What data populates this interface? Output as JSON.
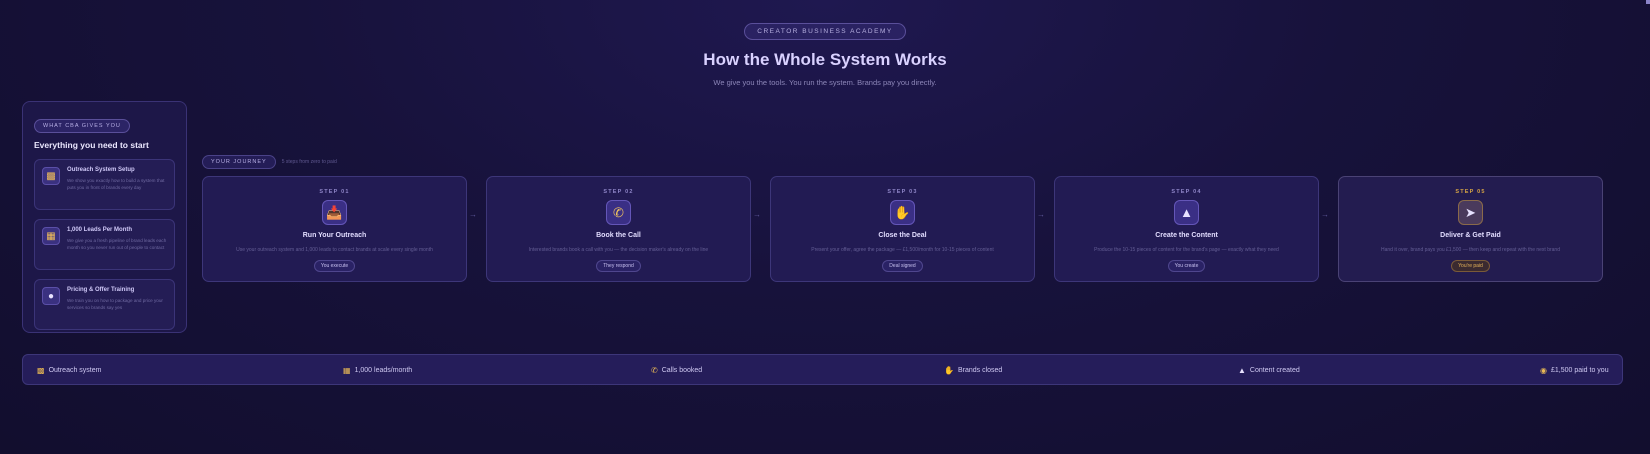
{
  "header": {
    "academy_label": "CREATOR BUSINESS ACADEMY",
    "title": "How the Whole System Works",
    "subtitle": "We give you the tools. You run the system. Brands pay you directly."
  },
  "sidebar": {
    "pill": "WHAT CBA GIVES YOU",
    "title": "Everything you need to start",
    "items": [
      {
        "icon": "folder-icon",
        "title": "Outreach System Setup",
        "desc": "We show you exactly how to build a system that puts you in front of brands every day"
      },
      {
        "icon": "clipboard-icon",
        "title": "1,000 Leads Per Month",
        "desc": "We give you a fresh pipeline of brand leads each month so you never run out of people to contact"
      },
      {
        "icon": "lightbulb-icon",
        "title": "Pricing & Offer Training",
        "desc": "We train you on how to package and price your services so brands say yes"
      }
    ]
  },
  "journey": {
    "pill": "YOUR JOURNEY",
    "sub": "5 steps from zero to paid"
  },
  "steps": [
    {
      "label": "STEP 01",
      "icon": "inbox-icon",
      "title": "Run Your Outreach",
      "desc": "Use your outreach system and 1,000 leads to contact brands at scale every single month",
      "badge": "You execute"
    },
    {
      "label": "STEP 02",
      "icon": "phone-icon",
      "title": "Book the Call",
      "desc": "Interested brands book a call with you — the decision maker's already on the line",
      "badge": "They respond"
    },
    {
      "label": "STEP 03",
      "icon": "handshake-icon",
      "title": "Close the Deal",
      "desc": "Present your offer, agree the package — £1,500/month for 10-15 pieces of content",
      "badge": "Deal signed"
    },
    {
      "label": "STEP 04",
      "icon": "megaphone-icon",
      "title": "Create the Content",
      "desc": "Produce the 10-15 pieces of content for the brand's page — exactly what they need",
      "badge": "You create"
    },
    {
      "label": "STEP 05",
      "icon": "rocket-icon",
      "title": "Deliver & Get Paid",
      "desc": "Hand it over, brand pays you £1,500 — then keep and repeat with the next brand",
      "badge": "You're paid"
    }
  ],
  "bottom_bar": [
    {
      "icon": "inbox-icon",
      "label": "Outreach system"
    },
    {
      "icon": "clipboard-icon",
      "label": "1,000 leads/month"
    },
    {
      "icon": "phone-icon",
      "label": "Calls booked"
    },
    {
      "icon": "handshake-icon",
      "label": "Brands closed"
    },
    {
      "icon": "megaphone-icon",
      "label": "Content created"
    },
    {
      "icon": "money-bag-icon",
      "label": "£1,500 paid to you"
    }
  ],
  "colors": {
    "background": "#17123b",
    "accent": "#d9d1ff",
    "gold": "#d7a545"
  }
}
